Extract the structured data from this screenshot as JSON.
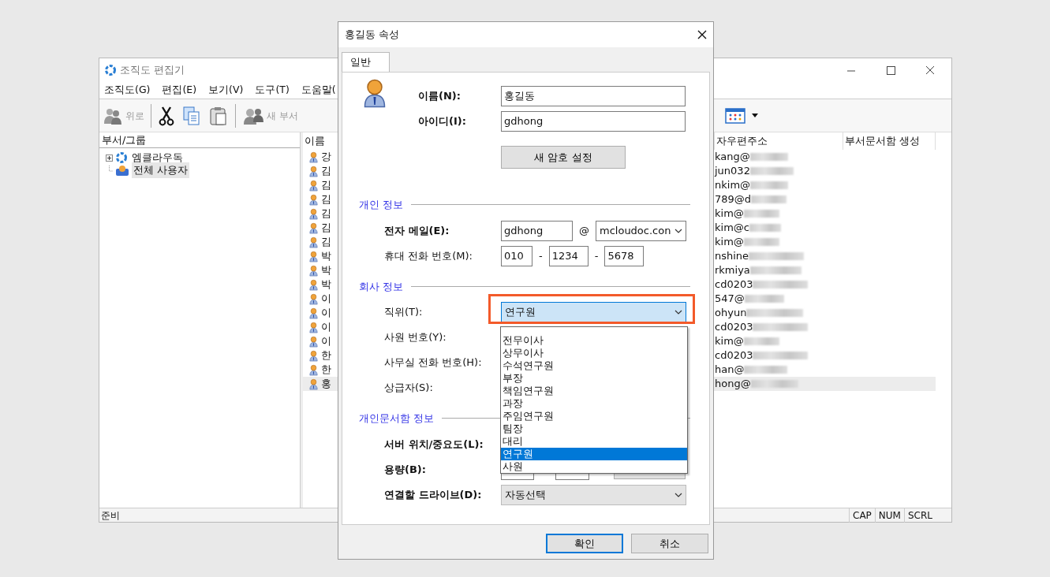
{
  "main_window": {
    "title": "조직도 편집기",
    "menu": [
      "조직도(G)",
      "편집(E)",
      "보기(V)",
      "도구(T)",
      "도움말("
    ],
    "toolbar": {
      "up_button": {
        "label": "위로",
        "disabled": true
      },
      "new_dept_button": {
        "label": "새 부서",
        "disabled": true
      }
    },
    "tree": {
      "header": "부서/그룹",
      "items": [
        {
          "label": "엠클라우독",
          "expandable": true,
          "expanded": false,
          "selected": false
        },
        {
          "label": "전체 사용자",
          "expandable": false,
          "selected": true
        }
      ]
    },
    "list": {
      "columns": [
        "이름",
        "자우편주소",
        "부서문서함 생성"
      ],
      "rows": [
        {
          "name": "강",
          "email": "kang@",
          "selected": false
        },
        {
          "name": "김",
          "email": "jun032",
          "selected": false
        },
        {
          "name": "김",
          "email": "nkim@",
          "selected": false
        },
        {
          "name": "김",
          "email": "789@d",
          "selected": false
        },
        {
          "name": "김",
          "email": "kim@",
          "selected": false
        },
        {
          "name": "김",
          "email": "kim@c",
          "selected": false
        },
        {
          "name": "김",
          "email": "kim@",
          "selected": false
        },
        {
          "name": "박",
          "email": "nshine",
          "selected": false
        },
        {
          "name": "박",
          "email": "rkmiya",
          "selected": false
        },
        {
          "name": "박",
          "email": "cd0203",
          "selected": false
        },
        {
          "name": "이",
          "email": "547@",
          "selected": false
        },
        {
          "name": "이",
          "email": "ohyun",
          "selected": false
        },
        {
          "name": "이",
          "email": "cd0203",
          "selected": false
        },
        {
          "name": "이",
          "email": "kim@",
          "selected": false
        },
        {
          "name": "한",
          "email": "cd0203",
          "selected": false
        },
        {
          "name": "한",
          "email": "han@",
          "selected": false
        },
        {
          "name": "홍",
          "email": "hong@",
          "selected": true
        }
      ]
    },
    "status_bar": {
      "text": "준비",
      "indicators": [
        "CAP",
        "NUM",
        "SCRL"
      ]
    }
  },
  "dialog": {
    "title": "홍길동 속성",
    "tabs": [
      {
        "label": "일반",
        "selected": true
      }
    ],
    "name_field": {
      "label": "이름(N):",
      "value": "홍길동"
    },
    "id_field": {
      "label": "아이디(I):",
      "value": "gdhong"
    },
    "password_button": "새 암호 설정",
    "sections": [
      {
        "title": "개인 정보",
        "rows": [
          {
            "kind": "email",
            "label": "전자 메일(E):",
            "bold": true,
            "value": "gdhong",
            "at": "@",
            "domain": "mcloudoc.con"
          },
          {
            "kind": "phone",
            "label": "휴대 전화 번호(M):",
            "bold": false,
            "parts": [
              "010",
              "1234",
              "5678"
            ],
            "separator": "-"
          }
        ]
      },
      {
        "title": "회사 정보",
        "rows": [
          {
            "kind": "position",
            "label": "직위(T):",
            "bold": false,
            "value": "연구원",
            "focused": true,
            "highlighted": true,
            "options": [
              {
                "label": "전무이사",
                "selected": false
              },
              {
                "label": "상무이사",
                "selected": false
              },
              {
                "label": "수석연구원",
                "selected": false
              },
              {
                "label": "부장",
                "selected": false
              },
              {
                "label": "책임연구원",
                "selected": false
              },
              {
                "label": "과장",
                "selected": false
              },
              {
                "label": "주임연구원",
                "selected": false
              },
              {
                "label": "팀장",
                "selected": false
              },
              {
                "label": "대리",
                "selected": false
              },
              {
                "label": "연구원",
                "selected": true
              },
              {
                "label": "사원",
                "selected": false
              }
            ]
          },
          {
            "kind": "plain",
            "label": "사원 번호(Y):",
            "bold": false
          },
          {
            "kind": "plain",
            "label": "사무실 전화 번호(H):",
            "bold": false
          },
          {
            "kind": "plain",
            "label": "상급자(S):",
            "bold": false
          }
        ]
      },
      {
        "title": "개인문서함 정보",
        "rows": [
          {
            "kind": "plain",
            "label": "서버 위치/중요도(L):",
            "bold": true
          },
          {
            "kind": "size",
            "label": "용량(B):",
            "bold": true
          },
          {
            "kind": "select",
            "label": "연결할 드라이브(D):",
            "bold": true,
            "value": "자동선택",
            "disabled": true
          }
        ]
      }
    ],
    "buttons": [
      {
        "label": "확인",
        "default": true
      },
      {
        "label": "취소",
        "default": false
      }
    ]
  }
}
